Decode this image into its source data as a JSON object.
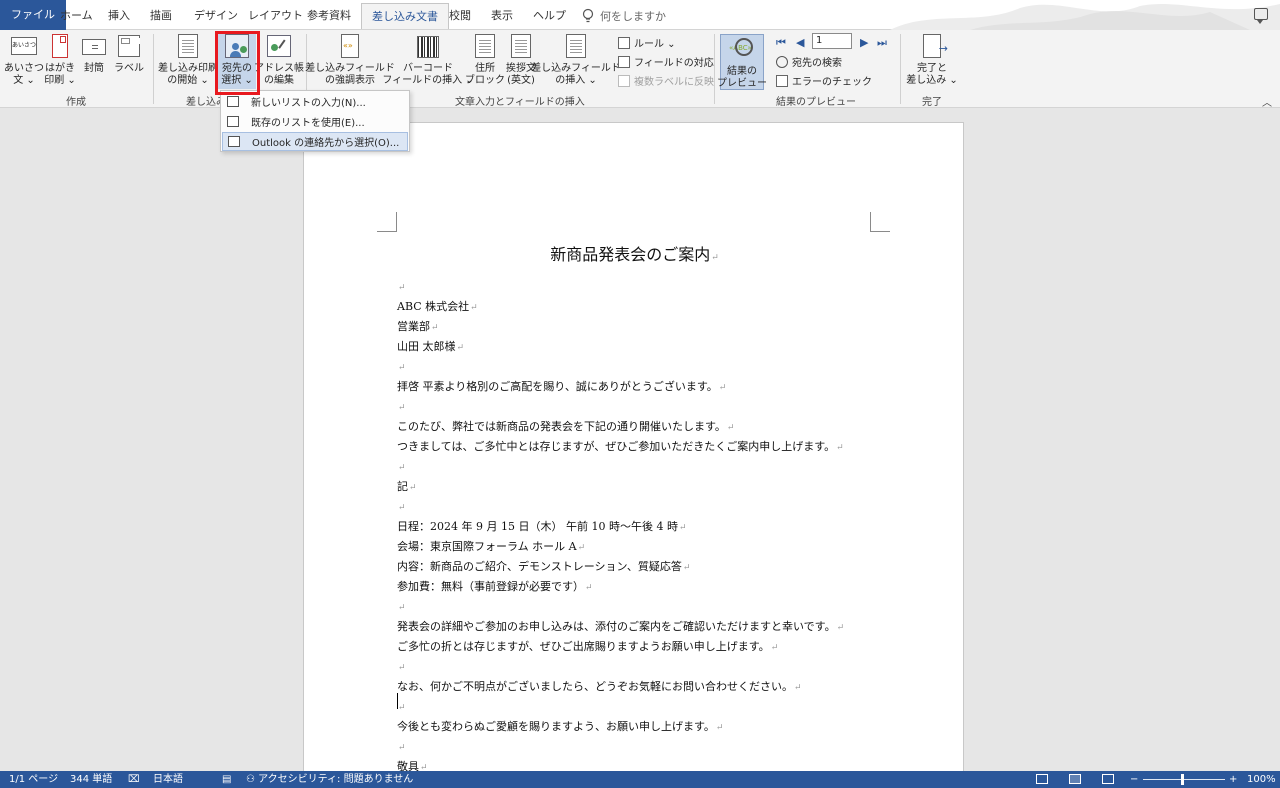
{
  "tabs": {
    "file": "ファイル",
    "home": "ホーム",
    "insert": "挿入",
    "draw": "描画",
    "design": "デザイン",
    "layout": "レイアウト",
    "references": "参考資料",
    "mailings": "差し込み文書",
    "review": "校閲",
    "view": "表示",
    "help": "ヘルプ",
    "tell_me": "何をしますか"
  },
  "ribbon": {
    "create_group": {
      "label": "作成",
      "greetings_line1": "あいさつ",
      "greetings_line2": "文 ⌄",
      "greetings_icon_text": "あいさつ",
      "postcard_line1": "はがき",
      "postcard_line2": "印刷 ⌄",
      "envelope": "封筒",
      "labels": "ラベル"
    },
    "start_group": {
      "label": "差し込み",
      "start_line1": "差し込み印刷",
      "start_line2": "の開始 ⌄",
      "select_line1": "宛先の",
      "select_line2": "選択 ⌄",
      "edit_line1": "アドレス帳",
      "edit_line2": "の編集"
    },
    "write_group": {
      "label": "文章入力とフィールドの挿入",
      "highlight_line1": "差し込みフィールド",
      "highlight_line2": "の強調表示",
      "barcode_line1": "バーコード",
      "barcode_line2": "フィールドの挿入 ⌄",
      "address_line1": "住所",
      "address_line2": "ブロック",
      "greeting_line1": "挨拶文",
      "greeting_line2": "(英文)",
      "insert_field_line1": "差し込みフィールド",
      "insert_field_line2": "の挿入 ⌄",
      "rules": "ルール ⌄",
      "match_fields": "フィールドの対応",
      "update_labels": "複数ラベルに反映"
    },
    "preview_group": {
      "label": "結果のプレビュー",
      "preview_line1": "結果の",
      "preview_line2": "プレビュー",
      "record": "1",
      "find_recipient": "宛先の検索",
      "check_errors": "エラーのチェック"
    },
    "finish_group": {
      "label": "完了",
      "finish_line1": "完了と",
      "finish_line2": "差し込み ⌄"
    }
  },
  "dropdown": {
    "items": [
      "新しいリストの入力(N)...",
      "既存のリストを使用(E)...",
      "Outlook の連絡先から選択(O)..."
    ]
  },
  "document": {
    "title": "新商品発表会のご案内",
    "lines": [
      "",
      "ABC 株式会社",
      "営業部",
      "山田  太郎様",
      "",
      "拝啓  平素より格別のご高配を賜り、誠にありがとうございます。",
      "",
      "このたび、弊社では新商品の発表会を下記の通り開催いたします。",
      "つきましては、ご多忙中とは存じますが、ぜひご参加いただきたくご案内申し上げます。",
      "",
      "記",
      "",
      "日程：2024 年 9 月 15 日（木） 午前 10 時〜午後 4 時",
      "会場：東京国際フォーラム  ホール A",
      "内容：新商品のご紹介、デモンストレーション、質疑応答",
      "参加費：無料（事前登録が必要です）",
      "",
      "発表会の詳細やご参加のお申し込みは、添付のご案内をご確認いただけますと幸いです。",
      "ご多忙の折とは存じますが、ぜひご出席賜りますようお願い申し上げます。",
      "",
      "なお、何かご不明点がございましたら、どうぞお気軽にお問い合わせください。",
      "",
      "今後とも変わらぬご愛顧を賜りますよう、お願い申し上げます。",
      "",
      "敬具"
    ],
    "paragraph_mark": "↵"
  },
  "statusbar": {
    "page": "1/1 ページ",
    "words": "344 単語",
    "language": "日本語",
    "accessibility": "アクセシビリティ: 問題ありません",
    "zoom_minus": "−",
    "zoom_plus": "+",
    "zoom": "100%"
  },
  "colors": {
    "accent": "#2b579a",
    "highlight": "#e8191f"
  }
}
